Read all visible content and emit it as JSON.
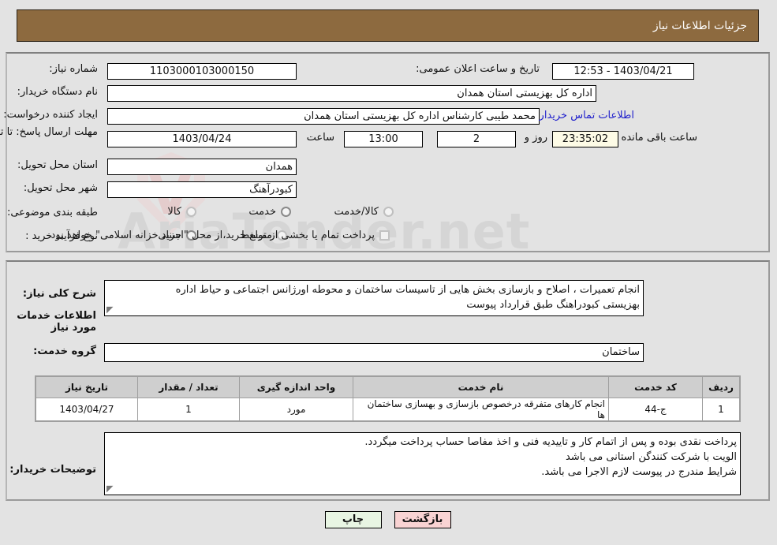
{
  "header": {
    "title": "جزئیات اطلاعات نیاز"
  },
  "watermark": {
    "text": "AriaTender.net"
  },
  "form": {
    "need_number_label": "شماره نیاز:",
    "need_number_value": "1103000103000150",
    "announce_datetime_label": "تاریخ و ساعت اعلان عمومی:",
    "announce_datetime_value": "1403/04/21 - 12:53",
    "buyer_org_label": "نام دستگاه خریدار:",
    "buyer_org_value": "اداره کل بهزیستی استان همدان",
    "creator_label": "ایجاد کننده درخواست:",
    "creator_value": "محمد طیبی کارشناس اداره کل بهزیستی استان همدان",
    "contact_link": "اطلاعات تماس خریدار",
    "deadline_label": "مهلت ارسال پاسخ: تا تاریخ:",
    "deadline_date": "1403/04/24",
    "deadline_time_label": "ساعت",
    "deadline_time": "13:00",
    "remaining_days": "2",
    "remaining_days_label": "روز و",
    "remaining_clock": "23:35:02",
    "remaining_suffix": "ساعت باقی مانده",
    "province_label": "استان محل تحویل:",
    "province_value": "همدان",
    "city_label": "شهر محل تحویل:",
    "city_value": "کبودرآهنگ",
    "category_label": "طبقه بندی موضوعی:",
    "category_options": [
      "کالا",
      "خدمت",
      "کالا/خدمت"
    ],
    "category_selected": "خدمت",
    "process_label": "نوع فرآیند خرید :",
    "process_options": [
      "جزیی",
      "متوسط"
    ],
    "process_selected": "جزیی",
    "treasury_checkbox_label": "پرداخت تمام یا بخشی از مبلغ خرید،از محل \"اسناد خزانه اسلامی\" خواهد بود.",
    "treasury_checked": false
  },
  "description": {
    "label": "شرح کلی نیاز:",
    "lines": [
      "انجام تعمیرات ، اصلاح و بازسازی بخش هایی از تاسیسات ساختمان و محوطه اورژانس اجتماعی و حیاط اداره",
      "بهزیستی کبودراهنگ طبق قرارداد پیوست"
    ],
    "section_heading": "اطلاعات خدمات مورد نیاز",
    "service_group_label": "گروه خدمت:",
    "service_group_value": "ساختمان"
  },
  "table": {
    "columns": [
      "ردیف",
      "کد خدمت",
      "نام خدمت",
      "واحد اندازه گیری",
      "تعداد / مقدار",
      "تاریخ نیاز"
    ],
    "rows": [
      {
        "index": "1",
        "code": "ج-44",
        "name": "انجام کارهای متفرقه درخصوص بازسازی و بهسازی ساختمان ها",
        "unit": "مورد",
        "quantity": "1",
        "date": "1403/04/27"
      }
    ]
  },
  "notes": {
    "label": "توضیحات خریدار:",
    "lines": [
      "پرداخت نقدی بوده و پس از اتمام کار و تاییدیه فنی و اخذ مفاصا حساب پرداخت میگردد.",
      "الویت با شرکت کنندگن استانی می باشد",
      "شرایط مندرج در پیوست لازم الاجرا می باشد."
    ]
  },
  "footer": {
    "print_label": "چاپ",
    "back_label": "بازگشت"
  }
}
